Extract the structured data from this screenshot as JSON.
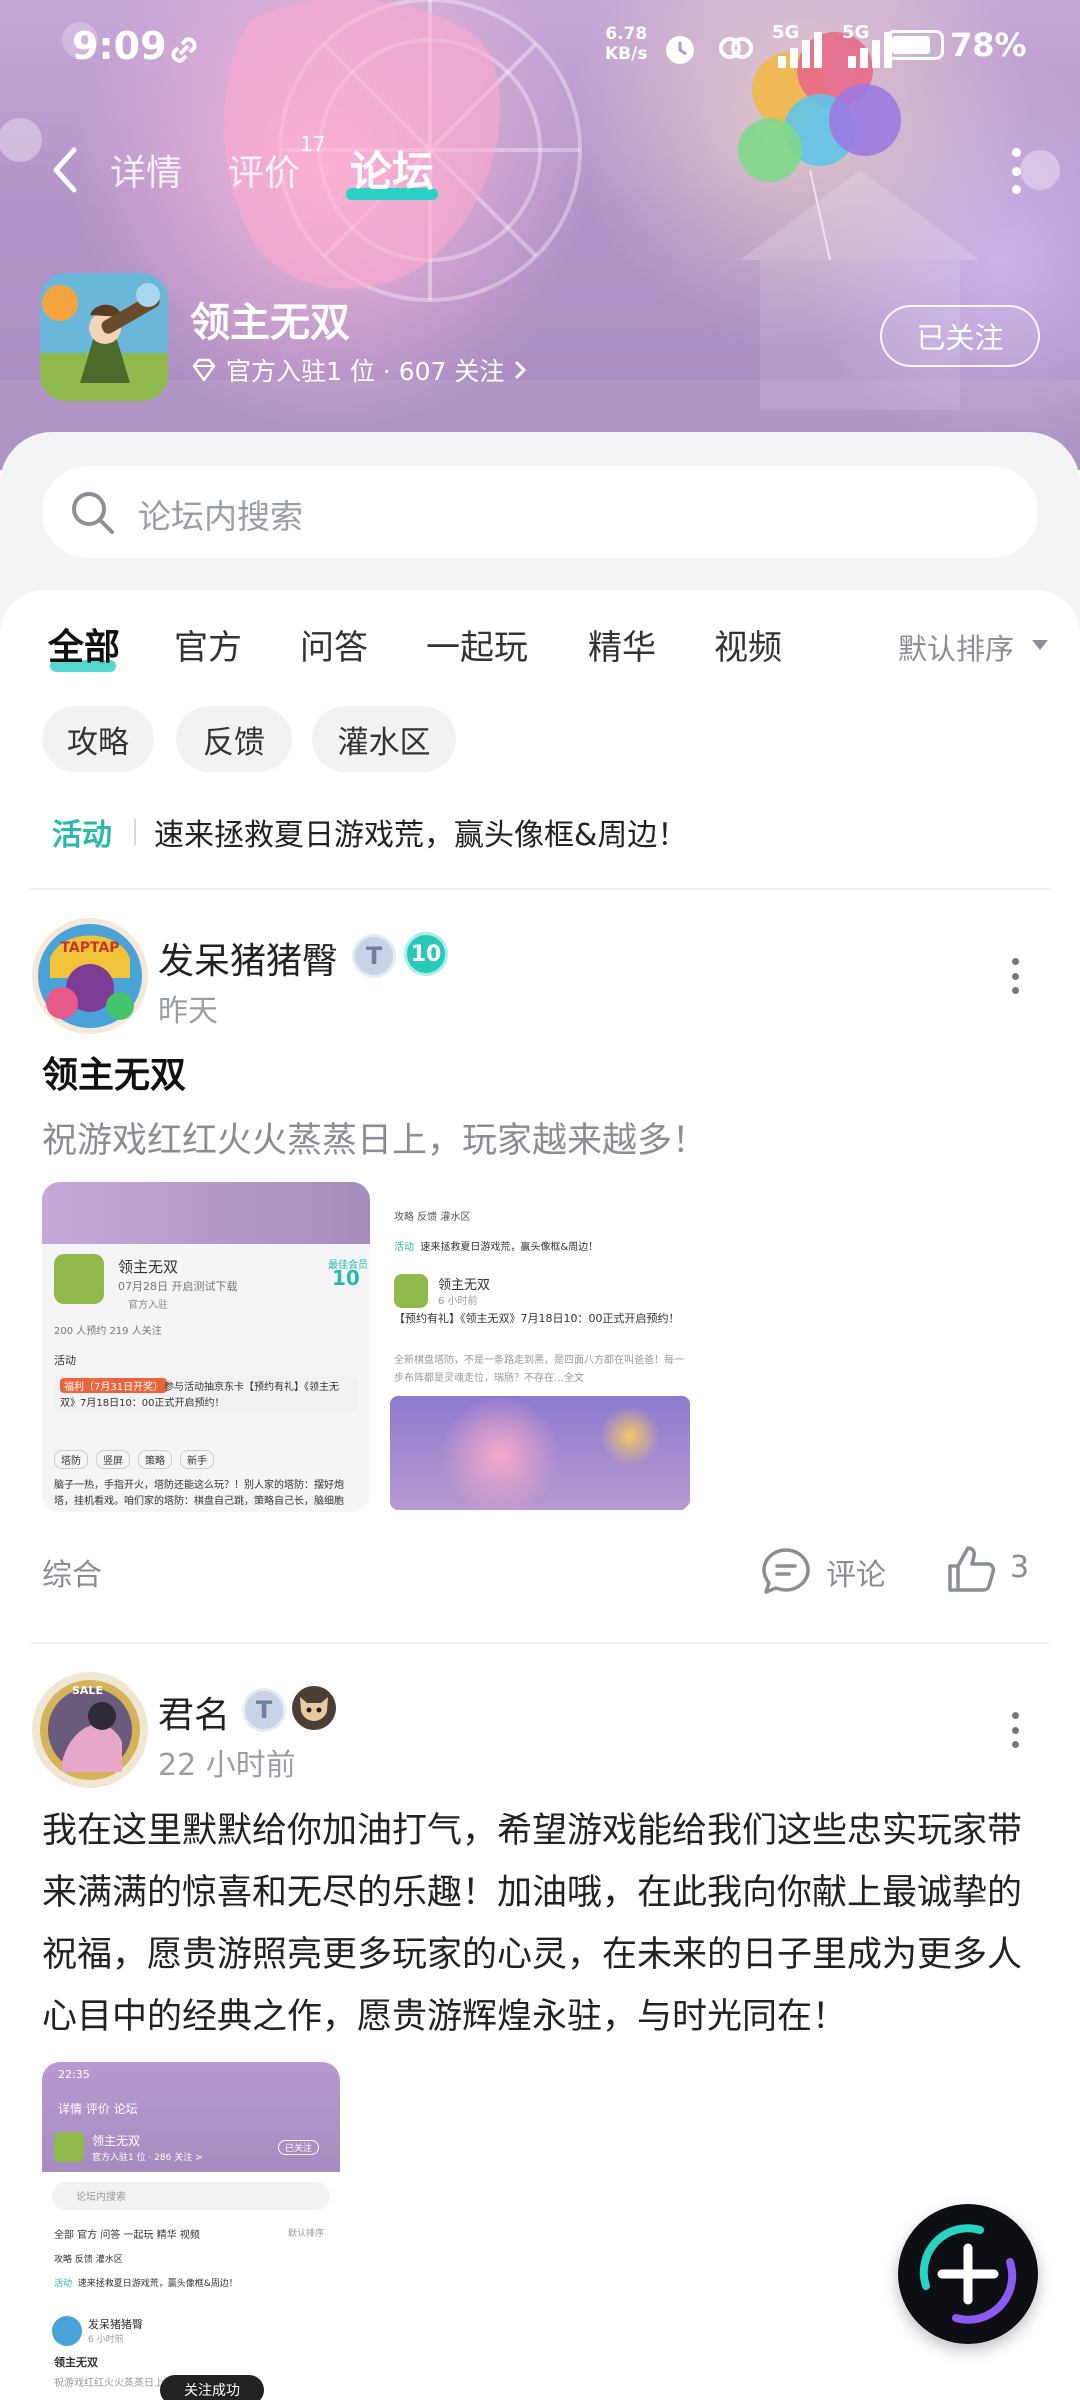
{
  "status_bar": {
    "time": "9:09",
    "net_speed_value": "6.78",
    "net_speed_unit": "KB/s",
    "signal_1": "5G",
    "signal_2": "5G",
    "battery": "78%"
  },
  "nav": {
    "tabs": [
      {
        "label": "详情"
      },
      {
        "label": "评价",
        "badge": "17"
      },
      {
        "label": "论坛"
      }
    ],
    "active_tab": "论坛"
  },
  "game": {
    "title": "领主无双",
    "meta": "官方入驻1 位 · 607 关注",
    "follow_label": "已关注"
  },
  "search": {
    "placeholder": "论坛内搜索"
  },
  "forum_tabs": [
    "全部",
    "官方",
    "问答",
    "一起玩",
    "精华",
    "视频"
  ],
  "sort_label": "默认排序",
  "chips": [
    "攻略",
    "反馈",
    "灌水区"
  ],
  "activity": {
    "tag": "活动",
    "text": "速来拯救夏日游戏荒，赢头像框&周边！"
  },
  "posts": [
    {
      "user": "发呆猪猪臀",
      "time": "昨天",
      "level": "10",
      "title": "领主无双",
      "body": "祝游戏红红火火蒸蒸日上，玩家越来越多！",
      "category": "综合",
      "comment_label": "评论",
      "likes": "3",
      "thumb1": {
        "game_title": "领主无双",
        "date": "07月28日 开启测试下载",
        "official": "官方入驻",
        "stats": "200 人预约   219 人关注",
        "activity": "活动",
        "notice_tag": "福利（7月31日开奖）",
        "notice": "参与活动抽京东卡【预约有礼】《领主无双》7月18日10：00正式开启预约！",
        "level_badge": "最佳会员",
        "level": "10",
        "chip_tags": [
          "塔防",
          "竖屏",
          "策略",
          "新手"
        ],
        "text": "脑子一热，手指开火，塔防还能这么玩？！别人家的塔防：摆好炮塔，挂机看戏。咱们家的塔防：棋盘自己跳，策略自己长，脑细胞"
      },
      "thumb2": {
        "tabs": "攻略  反馈  灌水区",
        "activity": "速来拯救夏日游戏荒，赢头像框&周边！",
        "user": "领主无双",
        "time": "6 小时前",
        "title": "【预约有礼】《领主无双》7月18日10：00正式开启预约！",
        "text": "全新棋盘塔防，不是一条路走到黑，是四面八方都在叫爸爸！每一步布阵都是灵魂走位，瑞肠？不存在…全文"
      }
    },
    {
      "user": "君名",
      "time": "22 小时前",
      "body": "我在这里默默给你加油打气，希望游戏能给我们这些忠实玩家带来满满的惊喜和无尽的乐趣！加油哦，在此我向你献上最诚挚的祝福，愿贵游照亮更多玩家的心灵，在未来的日子里成为更多人心目中的经典之作，愿贵游辉煌永驻，与时光同在！",
      "thumb": {
        "time": "22:35",
        "nav": "详情  评价  论坛",
        "game": "领主无双",
        "meta": "官方入驻1 位 · 286 关注 >",
        "follow": "已关注",
        "search": "论坛内搜索",
        "tabs": "全部  官方  问答  一起玩  精华  视频",
        "sort": "默认排序",
        "chips": "攻略  反馈  灌水区",
        "activity_tag": "活动",
        "activity": "速来拯救夏日游戏荒，赢头像框&周边！",
        "user": "发呆猪猪臀",
        "post_time": "6 小时前",
        "post_title": "领主无双",
        "post_body": "祝游戏红红火火蒸蒸日上，玩家越来越多！",
        "toast": "关注成功"
      }
    }
  ]
}
